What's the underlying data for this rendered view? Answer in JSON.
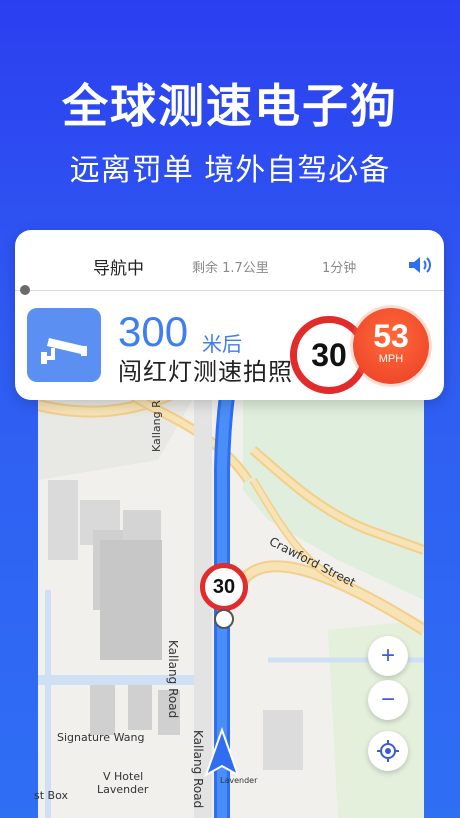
{
  "promo": {
    "headline": "全球测速电子狗",
    "subline": "远离罚单 境外自驾必备"
  },
  "nav_card": {
    "status": "导航中",
    "remaining": "剩余 1.7公里",
    "eta": "1分钟",
    "distance_value": "300",
    "distance_unit": "米后",
    "alert": "闯红灯测速拍照",
    "speed_limit": "30",
    "current_speed": "53",
    "speed_unit": "MPH"
  },
  "map": {
    "limit_sign": "30",
    "streets": [
      "Kallang Road",
      "Crawford Street",
      "Kallang Road",
      "Kallang Road"
    ],
    "pois": [
      "Signature Wang",
      "V Hotel",
      "Lavender",
      "st Box",
      "Lavender"
    ],
    "zoom_in": "+",
    "zoom_out": "−"
  },
  "colors": {
    "background": "#2f5bf2",
    "accent_blue": "#3d7ef0",
    "route": "#3b7df2",
    "alert_red": "#e22b2b",
    "speed_orange": "#ea3d25"
  },
  "icons": [
    "speed-camera-icon",
    "volume-icon",
    "zoom-in-icon",
    "zoom-out-icon",
    "locate-icon",
    "navigation-arrow-icon"
  ]
}
